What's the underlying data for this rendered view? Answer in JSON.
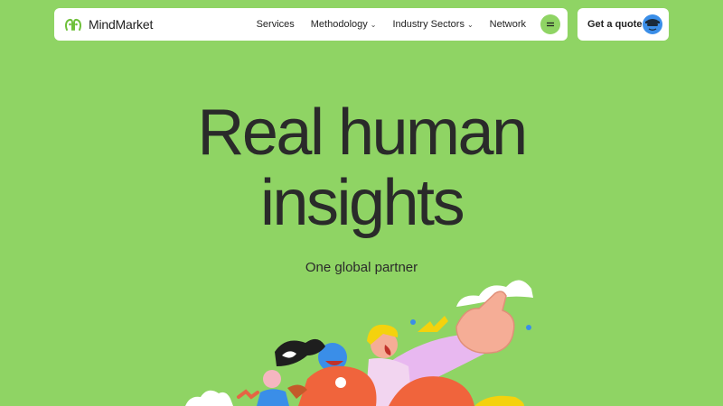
{
  "brand": {
    "name": "MindMarket",
    "accent": "#8fd464"
  },
  "nav": {
    "items": [
      {
        "label": "Services",
        "has_dropdown": false
      },
      {
        "label": "Methodology",
        "has_dropdown": true
      },
      {
        "label": "Industry Sectors",
        "has_dropdown": true
      },
      {
        "label": "Network",
        "has_dropdown": false
      }
    ],
    "menu_icon": "menu-icon"
  },
  "cta": {
    "label": "Get a quote",
    "icon": "avatar-icon"
  },
  "hero": {
    "title_line1": "Real human",
    "title_line2": "insights",
    "subtitle": "One global partner"
  }
}
